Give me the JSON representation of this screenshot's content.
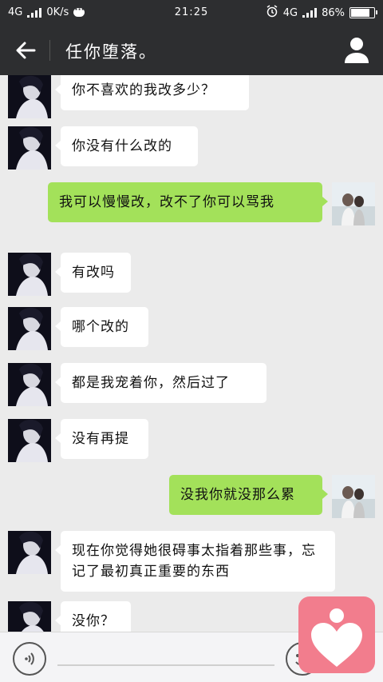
{
  "status_bar": {
    "network_left": "4G",
    "speed": "0K/s",
    "time": "21:25",
    "network_right": "4G",
    "battery": "86%",
    "battery_level": 0.86
  },
  "header": {
    "title": "任你堕落。"
  },
  "messages": [
    {
      "side": "in",
      "text": "你不喜欢的我改多少？"
    },
    {
      "side": "in",
      "text": "你没有什么改的"
    },
    {
      "side": "out",
      "text": "我可以慢慢改，改不了你可以骂我"
    },
    {
      "side": "in",
      "text": "有改吗"
    },
    {
      "side": "in",
      "text": "哪个改的"
    },
    {
      "side": "in",
      "text": "都是我宠着你，然后过了"
    },
    {
      "side": "in",
      "text": "没有再提"
    },
    {
      "side": "out",
      "text": "没我你就没那么累"
    },
    {
      "side": "in",
      "text": "现在你觉得她很碍事太指着那些事，忘记了最初真正重要的东西"
    },
    {
      "side": "in",
      "text": "没你？"
    }
  ],
  "icons": {
    "back": "back-arrow-icon",
    "profile": "person-icon",
    "voice": "voice-icon",
    "emoji": "emoji-icon",
    "widget": "heart-person-icon"
  },
  "colors": {
    "header_bg": "#2d2e30",
    "chat_bg": "#ebebeb",
    "incoming_bubble": "#ffffff",
    "outgoing_bubble": "#a3e15a",
    "widget": "#f27d8d"
  }
}
